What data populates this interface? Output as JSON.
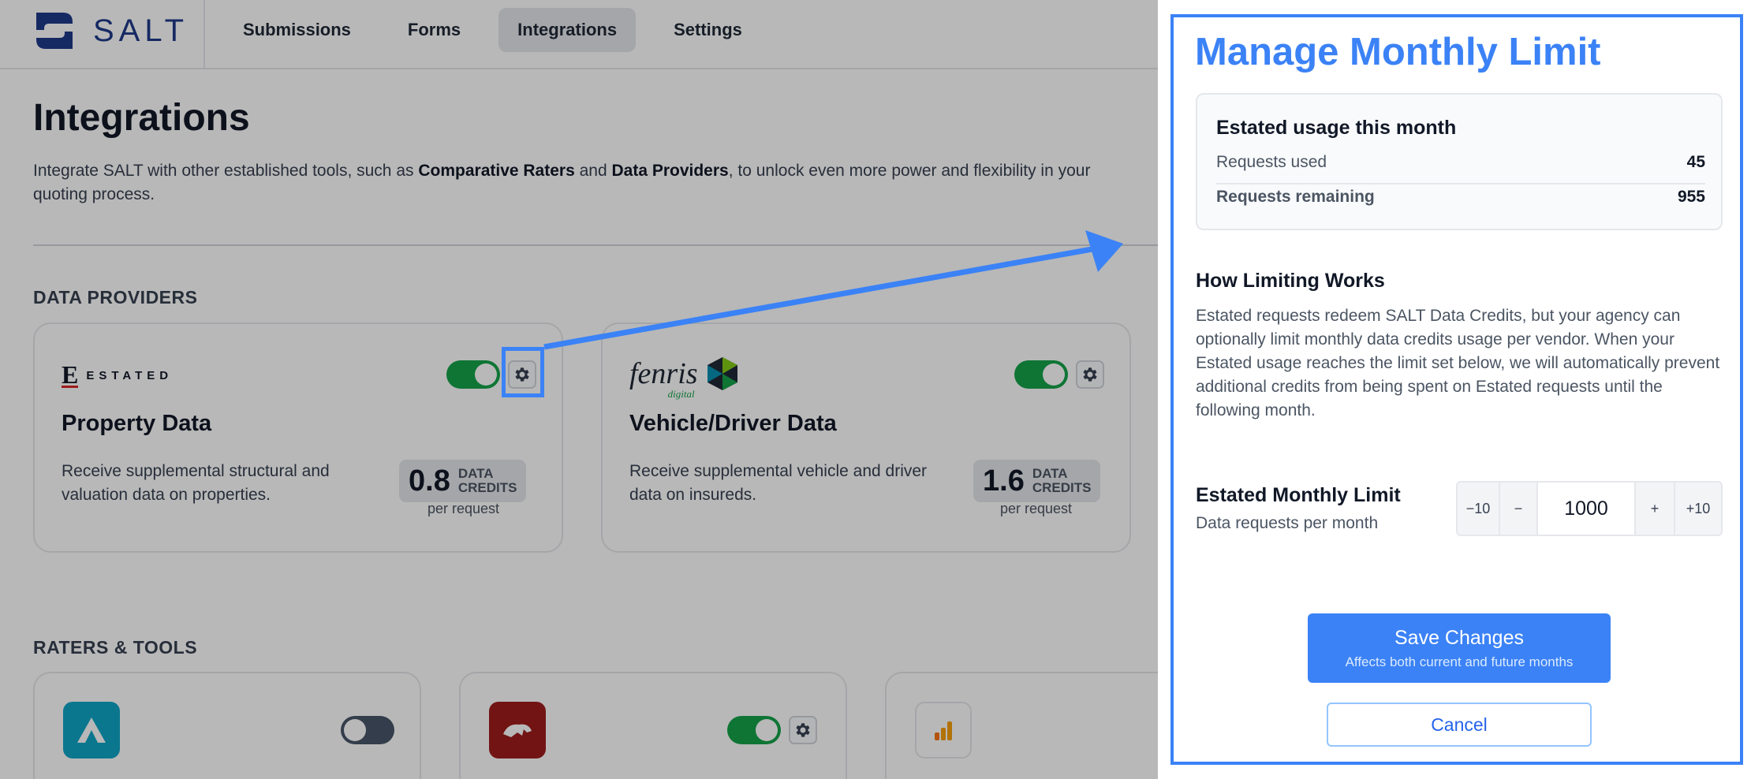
{
  "app": {
    "brand": "SALT",
    "nav": [
      {
        "label": "Submissions"
      },
      {
        "label": "Forms"
      },
      {
        "label": "Integrations",
        "active": true
      },
      {
        "label": "Settings"
      }
    ]
  },
  "page": {
    "title": "Integrations",
    "desc_1": "Integrate SALT with other established tools, such as ",
    "desc_bold_1": "Comparative Raters",
    "desc_2": " and ",
    "desc_bold_2": "Data Providers",
    "desc_3": ", to unlock even more power and flexibility in your quoting process."
  },
  "data_providers": {
    "label": "DATA PROVIDERS",
    "cards": [
      {
        "logo_letter": "E",
        "logo_word": "ESTATED",
        "title": "Property Data",
        "desc": "Receive supplemental structural and valuation data on properties.",
        "credits": "0.8",
        "credits_label_1": "DATA",
        "credits_label_2": "CREDITS",
        "per": "per request",
        "enabled": true
      },
      {
        "logo_word": "fenris",
        "logo_sub": "digital",
        "title": "Vehicle/Driver Data",
        "desc": "Receive supplemental vehicle and driver data on insureds.",
        "credits": "1.6",
        "credits_label_1": "DATA",
        "credits_label_2": "CREDITS",
        "per": "per request",
        "enabled": true
      }
    ]
  },
  "raters": {
    "label": "RATERS & TOOLS",
    "tools": [
      {
        "icon": "a-logo-icon",
        "enabled": false,
        "color": "#0ea5c6"
      },
      {
        "icon": "ezlynx-logo-icon",
        "enabled": true,
        "color": "#9f1d1d"
      },
      {
        "icon": "bar-chart-icon",
        "color": "#f59e0b"
      }
    ]
  },
  "drawer": {
    "title": "Manage Monthly Limit",
    "usage": {
      "title": "Estated usage this month",
      "used_label": "Requests used",
      "used_value": "45",
      "remaining_label": "Requests remaining",
      "remaining_value": "955"
    },
    "how_title": "How Limiting Works",
    "how_text": "Estated requests redeem SALT Data Credits, but your agency can optionally limit monthly data credits usage per vendor. When your Estated usage reaches the limit set below, we will automatically prevent additional credits from being spent on Estated requests until the following month.",
    "limit_title": "Estated Monthly Limit",
    "limit_sub": "Data requests per month",
    "stepper": {
      "minus10": "−10",
      "minus1": "−",
      "value": "1000",
      "plus1": "+",
      "plus10": "+10"
    },
    "save_label": "Save Changes",
    "save_sub": "Affects both current and future months",
    "cancel_label": "Cancel"
  },
  "colors": {
    "accent": "#3b82f6",
    "toggle_on": "#16a34a",
    "toggle_off": "#475569"
  }
}
